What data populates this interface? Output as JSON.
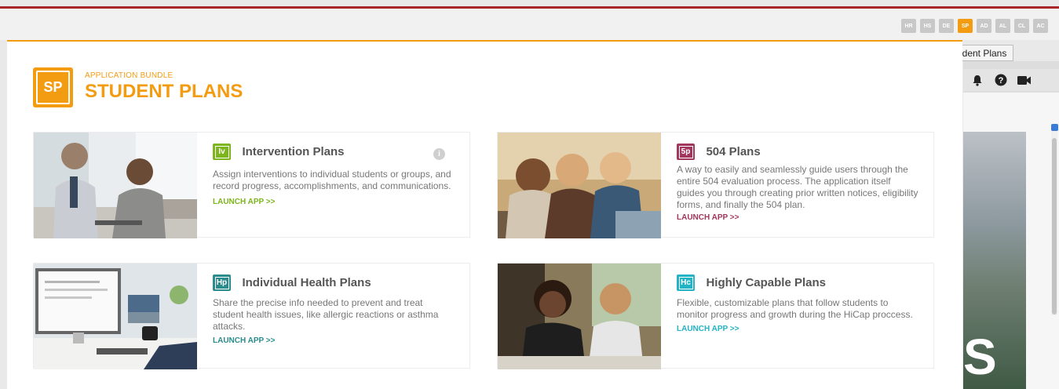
{
  "bundle_switcher": {
    "items": [
      {
        "code": "HR",
        "active": false
      },
      {
        "code": "HS",
        "active": false
      },
      {
        "code": "DE",
        "active": false
      },
      {
        "code": "SP",
        "active": true
      },
      {
        "code": "AD",
        "active": false
      },
      {
        "code": "AL",
        "active": false
      },
      {
        "code": "CL",
        "active": false
      },
      {
        "code": "AC",
        "active": false
      }
    ],
    "tooltip": "Student Plans"
  },
  "toolbar_icons": [
    "bell-icon",
    "help-icon",
    "video-icon"
  ],
  "panel": {
    "logo_text": "SP",
    "eyebrow": "APPLICATION BUNDLE",
    "title": "STUDENT PLANS",
    "accent_color": "#f39c12"
  },
  "apps": [
    {
      "icon_text": "Iv",
      "name": "Intervention Plans",
      "description": "Assign interventions to individual students or groups, and record progress, accomplishments, and communications.",
      "launch": "LAUNCH APP >>",
      "color": "#7cb51c",
      "info_icon": "i"
    },
    {
      "icon_text": "5p",
      "name": "504 Plans",
      "description": "A way to easily and seamlessly guide users through the entire 504 evaluation process. The application itself guides you through creating prior written notices, eligibility forms, and finally the 504 plan.",
      "launch": "LAUNCH APP >>",
      "color": "#a3365c"
    },
    {
      "icon_text": "Hp",
      "name": "Individual Health Plans",
      "description": "Share the precise info needed to prevent and treat student health issues, like allergic reactions or asthma attacks.",
      "launch": "LAUNCH APP >>",
      "color": "#2a8c8c"
    },
    {
      "icon_text": "Hc",
      "name": "Highly Capable Plans",
      "description": "Flexible, customizable plans that follow students to monitor progress and growth during the HiCap proccess.",
      "launch": "LAUNCH APP >>",
      "color": "#22b3c4"
    }
  ],
  "background_letter": "S"
}
